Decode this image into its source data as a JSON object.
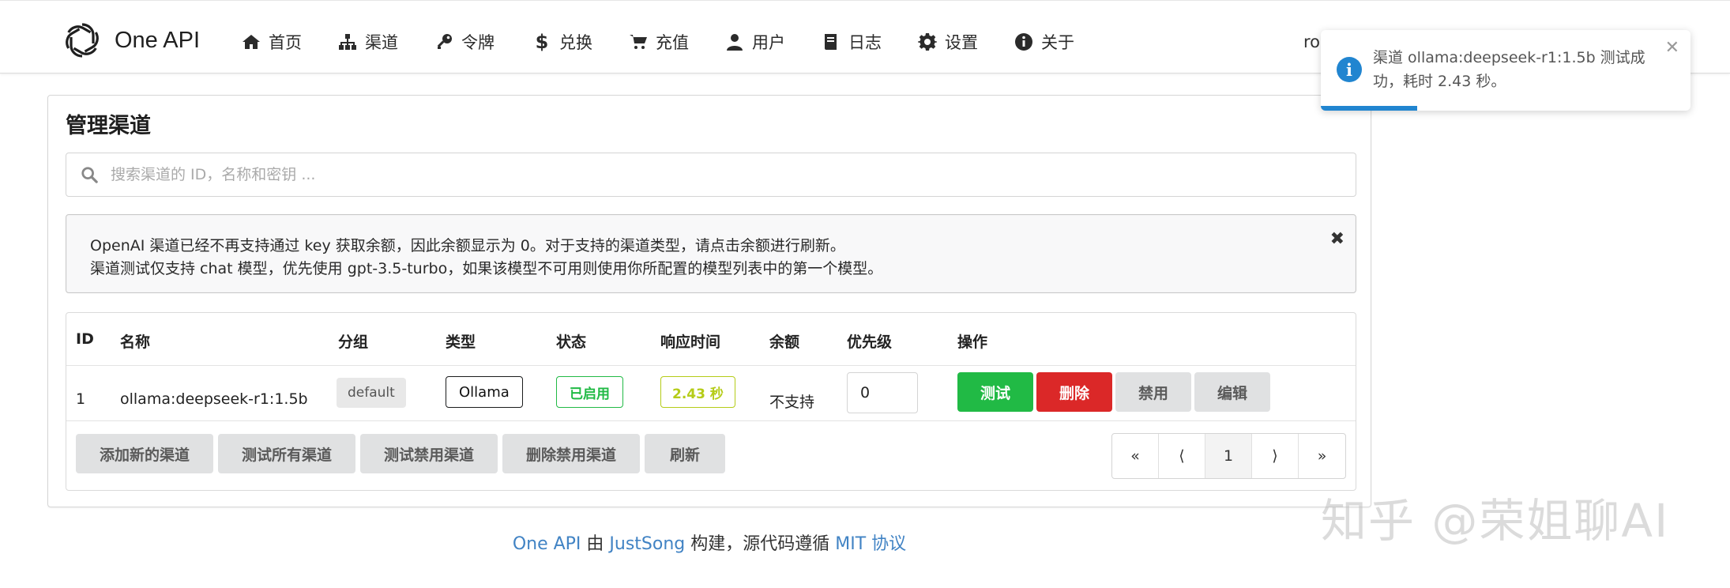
{
  "brand": "One API",
  "nav": [
    {
      "label": "首页",
      "icon": "home-icon"
    },
    {
      "label": "渠道",
      "icon": "sitemap-icon"
    },
    {
      "label": "令牌",
      "icon": "key-icon"
    },
    {
      "label": "兑换",
      "icon": "dollar-icon"
    },
    {
      "label": "充值",
      "icon": "cart-icon"
    },
    {
      "label": "用户",
      "icon": "user-icon"
    },
    {
      "label": "日志",
      "icon": "book-icon"
    },
    {
      "label": "设置",
      "icon": "gear-icon"
    },
    {
      "label": "关于",
      "icon": "info-icon"
    }
  ],
  "user_name": "ro",
  "page": {
    "title": "管理渠道",
    "search_placeholder": "搜索渠道的 ID，名称和密钥 ...",
    "notice": {
      "line1": "OpenAI 渠道已经不再支持通过 key 获取余额，因此余额显示为 0。对于支持的渠道类型，请点击余额进行刷新。",
      "line2": "渠道测试仅支持 chat 模型，优先使用 gpt-3.5-turbo，如果该模型不可用则使用你所配置的模型列表中的第一个模型。",
      "close": "✖"
    }
  },
  "table": {
    "headers": {
      "id": "ID",
      "name": "名称",
      "group": "分组",
      "type": "类型",
      "status": "状态",
      "response_time": "响应时间",
      "balance": "余额",
      "priority": "优先级",
      "actions": "操作"
    },
    "rows": [
      {
        "id": "1",
        "name": "ollama:deepseek-r1:1.5b",
        "group": "default",
        "type": "Ollama",
        "status": "已启用",
        "response_time": "2.43 秒",
        "balance": "不支持",
        "priority": "0",
        "actions": {
          "test": "测试",
          "delete": "删除",
          "disable": "禁用",
          "edit": "编辑"
        }
      }
    ]
  },
  "footer_buttons": {
    "add": "添加新的渠道",
    "test_all": "测试所有渠道",
    "test_disabled": "测试禁用渠道",
    "delete_disabled": "删除禁用渠道",
    "refresh": "刷新"
  },
  "pagination": {
    "first": "«",
    "prev": "⟨",
    "current": "1",
    "next": "⟩",
    "last": "»"
  },
  "footer": {
    "brand_link": "One API",
    "by": " 由 ",
    "author_link": "JustSong",
    "built": " 构建，源代码遵循 ",
    "license_link": "MIT 协议"
  },
  "toast": {
    "message": "渠道 ollama:deepseek-r1:1.5b 测试成功，耗时 2.43 秒。",
    "close": "✕",
    "progress": 0.26,
    "icon": "info-icon"
  },
  "watermark": "知乎 @荣姐聊AI",
  "colors": {
    "accent": "#2185d0",
    "green": "#21ba45",
    "red": "#db2828",
    "olive": "#b5cc18"
  }
}
